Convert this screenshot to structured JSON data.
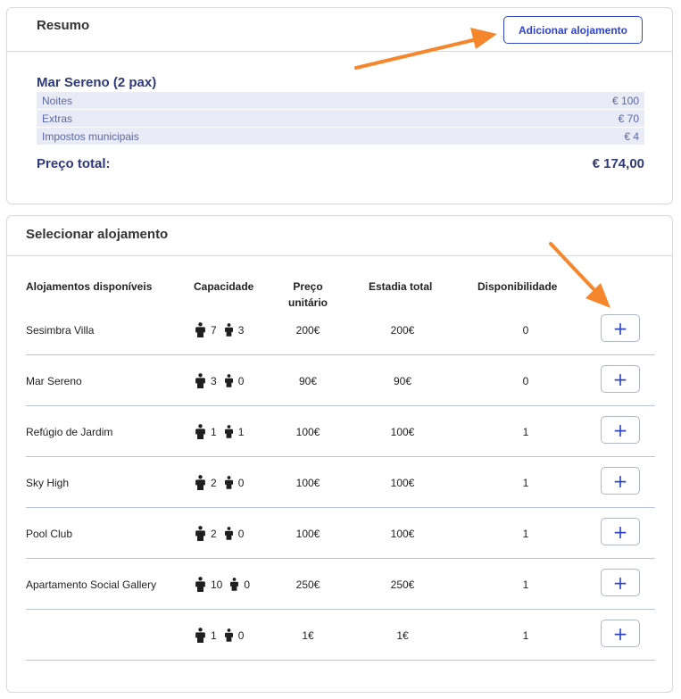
{
  "summary": {
    "title": "Resumo",
    "add_button_label": "Adicionar alojamento",
    "room_name": "Mar Sereno (2 pax)",
    "lines": [
      {
        "label": "Noites",
        "amount": "€ 100"
      },
      {
        "label": "Extras",
        "amount": "€ 70"
      },
      {
        "label": "Impostos municipais",
        "amount": "€ 4"
      }
    ],
    "total_label": "Preço total:",
    "total_amount": "€ 174,00"
  },
  "select": {
    "title": "Selecionar alojamento",
    "headers": {
      "name": "Alojamentos disponíveis",
      "capacity": "Capacidade",
      "unit_price_line1": "Preço",
      "unit_price_line2": "unitário",
      "total_stay": "Estadia total",
      "availability": "Disponibilidade"
    },
    "add_label": "+",
    "rows": [
      {
        "name": "Sesimbra Villa",
        "adults": "7",
        "children": "3",
        "unit_price": "200€",
        "total": "200€",
        "availability": "0"
      },
      {
        "name": "Mar Sereno",
        "adults": "3",
        "children": "0",
        "unit_price": "90€",
        "total": "90€",
        "availability": "0"
      },
      {
        "name": "Refúgio de Jardim",
        "adults": "1",
        "children": "1",
        "unit_price": "100€",
        "total": "100€",
        "availability": "1"
      },
      {
        "name": "Sky High",
        "adults": "2",
        "children": "0",
        "unit_price": "100€",
        "total": "100€",
        "availability": "1"
      },
      {
        "name": "Pool Club",
        "adults": "2",
        "children": "0",
        "unit_price": "100€",
        "total": "100€",
        "availability": "1"
      },
      {
        "name": "Apartamento Social Gallery",
        "adults": "10",
        "children": "0",
        "unit_price": "250€",
        "total": "250€",
        "availability": "1"
      },
      {
        "name": "",
        "adults": "1",
        "children": "0",
        "unit_price": "1€",
        "total": "1€",
        "availability": "1"
      }
    ]
  },
  "colors": {
    "accent": "#2f45c6",
    "navy": "#2e3a7a",
    "annotation_arrow": "#f5862c",
    "summary_row_bg": "#e9ebf6"
  },
  "icons": {
    "adult": "adult-person-icon",
    "child": "child-person-icon",
    "add": "plus-icon",
    "annotation": "annotation-arrow"
  }
}
